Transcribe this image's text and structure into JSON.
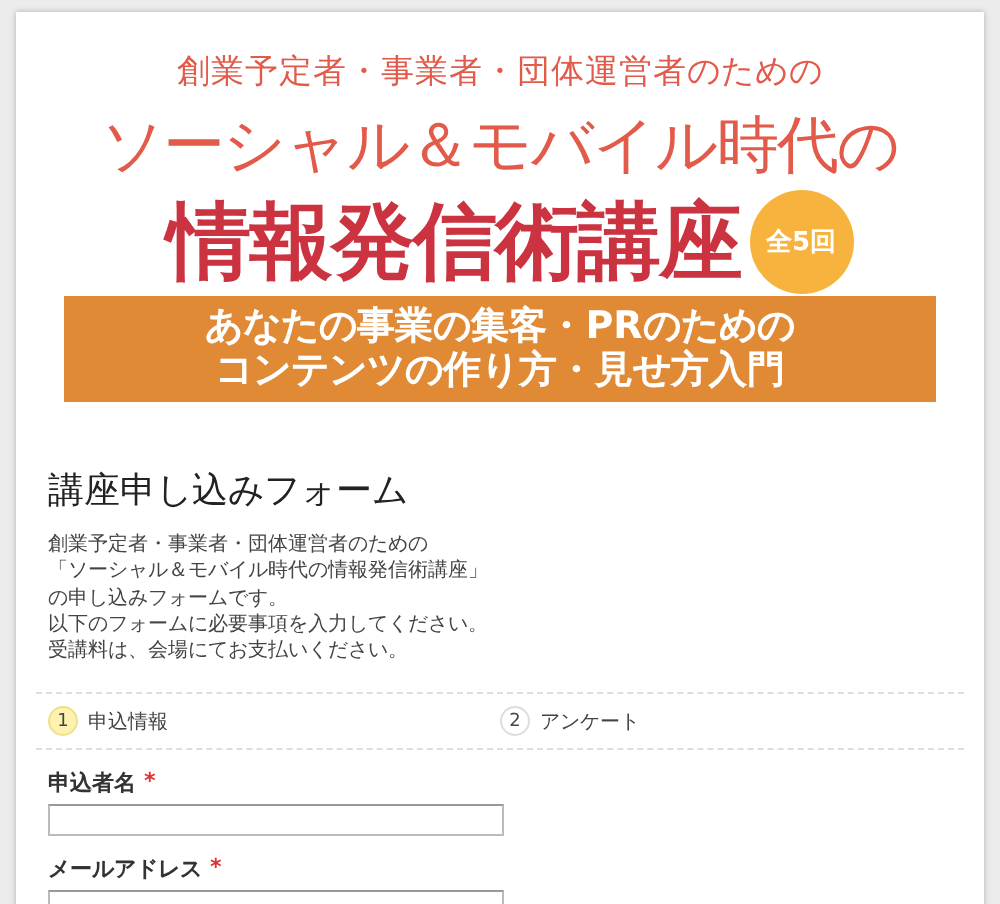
{
  "banner": {
    "subtitle": "創業予定者・事業者・団体運営者のための",
    "title_line1": "ソーシャル＆モバイル時代の",
    "title_line2": "情報発信術講座",
    "badge": "全5回",
    "tagline": [
      "あなたの事業の集客・PRのための",
      "コンテンツの作り方・見せ方入門"
    ]
  },
  "form": {
    "title": "講座申し込みフォーム",
    "description": [
      "創業予定者・事業者・団体運営者のための",
      "「ソーシャル＆モバイル時代の情報発信術講座」",
      "の申し込みフォームです。",
      "以下のフォームに必要事項を入力してください。",
      "受講料は、会場にてお支払いください。"
    ],
    "steps": [
      {
        "number": "1",
        "label": "申込情報",
        "selected": true
      },
      {
        "number": "2",
        "label": "アンケート",
        "selected": false
      }
    ],
    "fields": [
      {
        "label": "申込者名",
        "required_mark": "*"
      },
      {
        "label": "メールアドレス",
        "required_mark": "*"
      }
    ]
  }
}
